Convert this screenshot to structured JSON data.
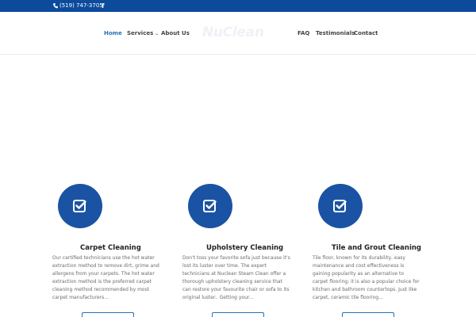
{
  "topbar": {
    "phone": "(519) 747-3705",
    "social_icon": "facebook-icon",
    "background_color": "#0c4a9c"
  },
  "nav": {
    "items": [
      {
        "label": "Home"
      },
      {
        "label": "Services"
      },
      {
        "label": "About Us"
      },
      {
        "label": "FAQ"
      },
      {
        "label": "Testimonials"
      },
      {
        "label": "Contact"
      }
    ],
    "active_color": "#2271b8"
  },
  "logo": {
    "text": "NuClean"
  },
  "features": [
    {
      "icon": "checkbox-icon",
      "title": "Carpet Cleaning",
      "body": "Our certified technicians use the hot water extraction method to remove dirt, grime and allergens from your carpets. The hot water extraction method is the preferred carpet cleaning method recommended by most carpet manufacturers..."
    },
    {
      "icon": "checkbox-icon",
      "title": "Upholstery Cleaning",
      "body": "Don't toss your favorite sofa just because it's lost its luster over time. The expert technicians at Nuclean Steam Clean offer a thorough upholstery cleaning service that can restore your favourite chair or sofa to its original luster.. Getting your..."
    },
    {
      "icon": "checkbox-icon",
      "title": "Tile and Grout Cleaning",
      "body": "Tile floor, known for its durability, easy maintenance and cost effectiveness is gaining popularity as an alternative to carpet flooring; it is also a popular choice for kitchen and bathroom countertops. Just like carpet, ceramic tile flooring..."
    }
  ],
  "accent_color": "#1a53a3"
}
